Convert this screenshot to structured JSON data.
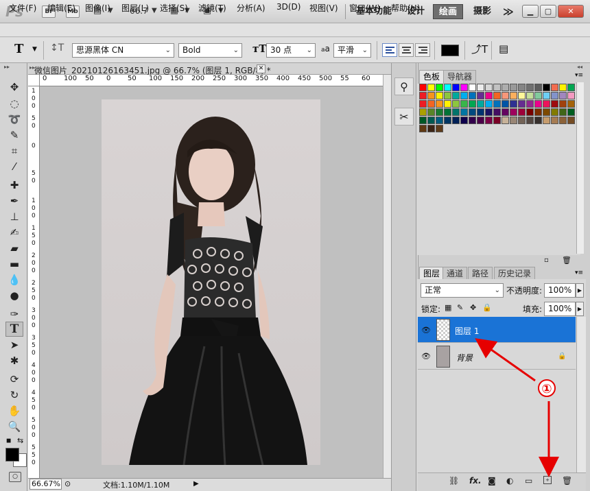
{
  "titlebar": {
    "app_logo": "Ps",
    "br_label": "Br",
    "mb_label": "Mb",
    "zoom_value": "66.7",
    "workspaces": [
      "基本功能",
      "设计",
      "绘画",
      "摄影"
    ],
    "more": "≫"
  },
  "menu": [
    "文件(F)",
    "编辑(E)",
    "图像(I)",
    "图层(L)",
    "选择(S)",
    "滤镜(T)",
    "分析(A)",
    "3D(D)",
    "视图(V)",
    "窗口(W)",
    "帮助(H)"
  ],
  "options": {
    "font_family": "思源黑体 CN",
    "font_style": "Bold",
    "font_size": "30 点",
    "aa_label": "a",
    "aa_mode": "平滑",
    "text_color": "#000000"
  },
  "document": {
    "tab_title": "微信图片_20210126163451.jpg @ 66.7% (图层 1, RGB/8) *",
    "ruler_top": [
      "0",
      "100",
      "50",
      "0",
      "50",
      "100",
      "150",
      "200",
      "250",
      "300",
      "350",
      "400",
      "450",
      "500",
      "55",
      "60"
    ],
    "ruler_left": [
      [
        "1",
        "0",
        "0"
      ],
      [
        "5",
        "0"
      ],
      [
        "0"
      ],
      [
        "5",
        "0"
      ],
      [
        "1",
        "0",
        "0"
      ],
      [
        "1",
        "5",
        "0"
      ],
      [
        "2",
        "0",
        "0"
      ],
      [
        "2",
        "5",
        "0"
      ],
      [
        "3",
        "0",
        "0"
      ],
      [
        "3",
        "5",
        "0"
      ],
      [
        "4",
        "0",
        "0"
      ],
      [
        "4",
        "5",
        "0"
      ],
      [
        "5",
        "0",
        "0"
      ],
      [
        "5",
        "5",
        "0"
      ]
    ],
    "zoom": "66.67%",
    "status": "文档:1.10M/1.10M"
  },
  "swatches": {
    "tabs": [
      "色板",
      "导航器"
    ],
    "colors": [
      "#ff0000",
      "#ffff00",
      "#00ff00",
      "#00ffff",
      "#0000ff",
      "#ff00ff",
      "#ffffff",
      "#ebebeb",
      "#d6d6d6",
      "#c2c2c2",
      "#adadad",
      "#999999",
      "#858585",
      "#707070",
      "#5c5c5c",
      "#000000",
      "#f26c4f",
      "#fff200",
      "#00a651",
      "#ee1d24",
      "#f7941d",
      "#fff200",
      "#8dc63f",
      "#00a99d",
      "#00aeef",
      "#0072bc",
      "#662d91",
      "#ec008c",
      "#f26522",
      "#f7977a",
      "#fbaf5d",
      "#fff79a",
      "#c4df9b",
      "#82ca9d",
      "#6dcff6",
      "#8393ca",
      "#a187be",
      "#f49ac1",
      "#ed1c24",
      "#f26522",
      "#f7941d",
      "#fff200",
      "#8dc63f",
      "#39b54a",
      "#00a651",
      "#00a99d",
      "#00aeef",
      "#0072bc",
      "#0054a6",
      "#2e3192",
      "#662d91",
      "#92278f",
      "#ec008c",
      "#ed145b",
      "#9e0b0f",
      "#a0410d",
      "#a3620a",
      "#aba000",
      "#598527",
      "#197b30",
      "#007236",
      "#00746b",
      "#0076a3",
      "#004a80",
      "#003471",
      "#1b1464",
      "#440e62",
      "#630460",
      "#9e005d",
      "#9e0039",
      "#790000",
      "#7b2e00",
      "#7d4900",
      "#827b00",
      "#406618",
      "#005e20",
      "#005826",
      "#005952",
      "#005b7f",
      "#003663",
      "#002157",
      "#0d004c",
      "#32004b",
      "#4b0049",
      "#7b0046",
      "#7a0026",
      "#c7b299",
      "#998675",
      "#736357",
      "#534741",
      "#37302d",
      "#c69c6d",
      "#a67c52",
      "#8c6239",
      "#754c24",
      "#603913",
      "#3c2415",
      "#5e3b1a"
    ]
  },
  "layers": {
    "tabs": [
      "图层",
      "通道",
      "路径",
      "历史记录"
    ],
    "blend_mode": "正常",
    "opacity_label": "不透明度:",
    "opacity_value": "100%",
    "lock_label": "锁定:",
    "fill_label": "填充:",
    "fill_value": "100%",
    "items": [
      {
        "name": "图层 1",
        "selected": true
      },
      {
        "name": "背景",
        "selected": false
      }
    ],
    "annotation": "①"
  }
}
